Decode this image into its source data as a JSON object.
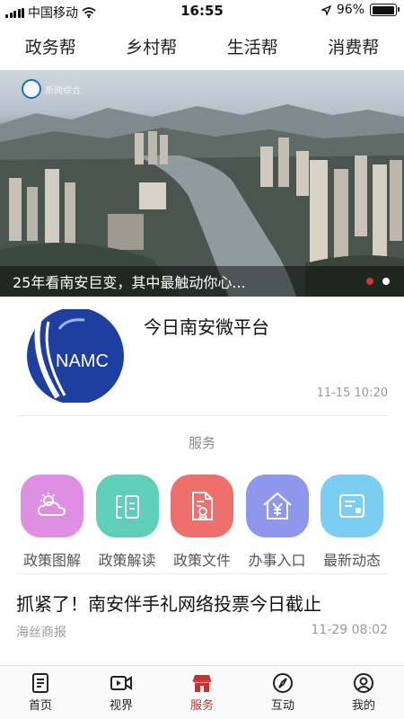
{
  "status_bar": {
    "carrier": "中国移动",
    "time": "16:55",
    "battery": "96%",
    "battery_level": 0.96
  },
  "top_tabs": [
    {
      "label": "政务帮",
      "active": true
    },
    {
      "label": "乡村帮",
      "active": false
    },
    {
      "label": "生活帮",
      "active": false
    },
    {
      "label": "消费帮",
      "active": false
    }
  ],
  "banner": {
    "caption": "25年看南安巨变，其中最触动你心...",
    "logo_text": "新闻综合",
    "slide_count": 2,
    "active_slide": 1
  },
  "feature": {
    "logo_text": "NAMC",
    "title": "今日南安微平台",
    "time": "11-15 10:20"
  },
  "services": {
    "title": "服务",
    "items": [
      {
        "label": "政策图解",
        "icon": "weather-cloud-icon",
        "color": "#de8fe2"
      },
      {
        "label": "政策解读",
        "icon": "policy-reading-icon",
        "color": "#5fcfba"
      },
      {
        "label": "政策文件",
        "icon": "document-seal-icon",
        "color": "#ef6f6c"
      },
      {
        "label": "办事入口",
        "icon": "house-yen-icon",
        "color": "#8e97ec"
      },
      {
        "label": "最新动态",
        "icon": "news-card-icon",
        "color": "#7ccdf2"
      }
    ]
  },
  "news": {
    "title": "抓紧了！南安伴手礼网络投票今日截止",
    "source": "海丝商报",
    "time": "11-29 08:02"
  },
  "bottom_nav": [
    {
      "label": "首页",
      "icon": "home-doc-icon",
      "active": false
    },
    {
      "label": "视界",
      "icon": "video-camera-icon",
      "active": false
    },
    {
      "label": "服务",
      "icon": "store-icon",
      "active": true
    },
    {
      "label": "互动",
      "icon": "compass-icon",
      "active": false
    },
    {
      "label": "我的",
      "icon": "user-icon",
      "active": false
    }
  ],
  "colors": {
    "accent": "#c8312d"
  }
}
